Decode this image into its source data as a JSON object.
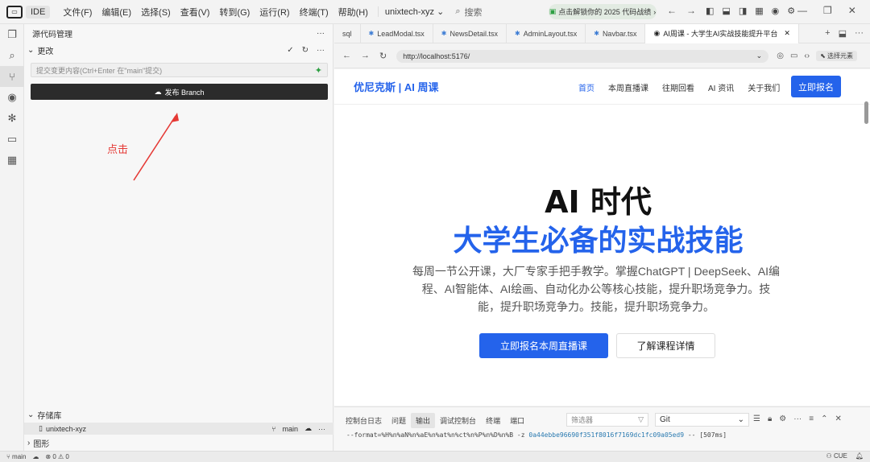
{
  "titlebar": {
    "ide_label": "IDE",
    "menus": [
      "文件(F)",
      "编辑(E)",
      "选择(S)",
      "查看(V)",
      "转到(G)",
      "运行(R)",
      "终端(T)",
      "帮助(H)"
    ],
    "project": "unixtech-xyz",
    "search": "搜索",
    "banner": "点击解锁你的 2025 代码战绩"
  },
  "sidebar": {
    "title": "源代码管理",
    "changes_label": "更改",
    "commit_placeholder": "提交变更内容(Ctrl+Enter 在\"main\"提交)",
    "publish_label": "发布 Branch",
    "annotation": "点击",
    "repos_label": "存储库",
    "repo_name": "unixtech-xyz",
    "branch": "main",
    "graph_label": "图形"
  },
  "tabs": [
    {
      "label": "sql",
      "icon": ""
    },
    {
      "label": "LeadModal.tsx",
      "icon": "TS"
    },
    {
      "label": "NewsDetail.tsx",
      "icon": "TS"
    },
    {
      "label": "AdminLayout.tsx",
      "icon": "TS"
    },
    {
      "label": "Navbar.tsx",
      "icon": "TS"
    },
    {
      "label": "AI周课 - 大学生AI实战技能提升平台",
      "icon": "eye"
    }
  ],
  "browser": {
    "url": "http://localhost:5176/",
    "select_element": "选择元素"
  },
  "webpage": {
    "brand": "优尼克斯 | AI 周课",
    "nav": [
      "首页",
      "本周直播课",
      "往期回看",
      "AI 资讯",
      "关于我们"
    ],
    "signup": "立即报名",
    "h1": "AI 时代",
    "h2": "大学生必备的实战技能",
    "description": "每周一节公开课，大厂专家手把手教学。掌握ChatGPT | DeepSeek、AI编程、AI智能体、AI绘画、自动化办公等核心技能，提升职场竞争力。技能，提升职场竞争力。技能，提升职场竞争力。",
    "cta_primary": "立即报名本周直播课",
    "cta_secondary": "了解课程详情"
  },
  "panel": {
    "tabs": [
      "控制台日志",
      "问题",
      "输出",
      "调试控制台",
      "终端",
      "端口"
    ],
    "active_tab": "输出",
    "filter_placeholder": "筛选器",
    "source": "Git",
    "output_prefix": "--format=%H%n%aN%n%aE%n%at%n%ct%n%P%n%D%n%B -z ",
    "output_hash": "0a44ebbe96690f351f8016f7169dc1fc09a05ed9",
    "output_suffix": " -- [507ms]"
  },
  "statusbar": {
    "branch": "main",
    "errors": "0",
    "warnings": "0",
    "encoding": "CUE"
  }
}
